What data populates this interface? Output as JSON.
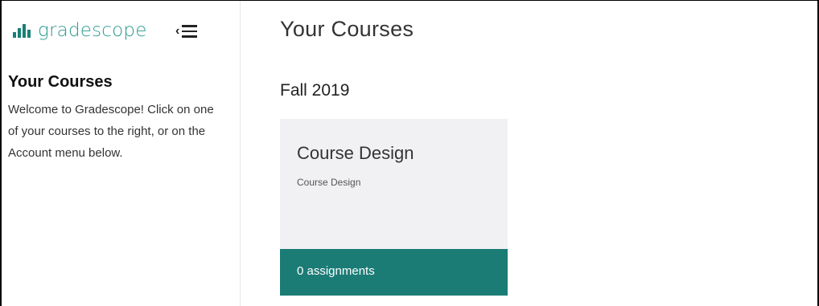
{
  "sidebar": {
    "brand_name": "gradescope",
    "heading": "Your Courses",
    "welcome_text": "Welcome to Gradescope! Click on one of your courses to the right, or on the Account menu below."
  },
  "main": {
    "title": "Your Courses",
    "term": "Fall 2019",
    "courses": [
      {
        "name": "Course Design",
        "subtitle": "Course Design",
        "assignments_label": "0 assignments"
      }
    ]
  },
  "colors": {
    "brand": "#2a9a8f",
    "card_footer": "#1b7c76",
    "card_background": "#f1f1f4"
  },
  "icons": {
    "logo": "bar-chart-icon",
    "collapse": "chevron-left-icon",
    "menu": "hamburger-icon"
  }
}
